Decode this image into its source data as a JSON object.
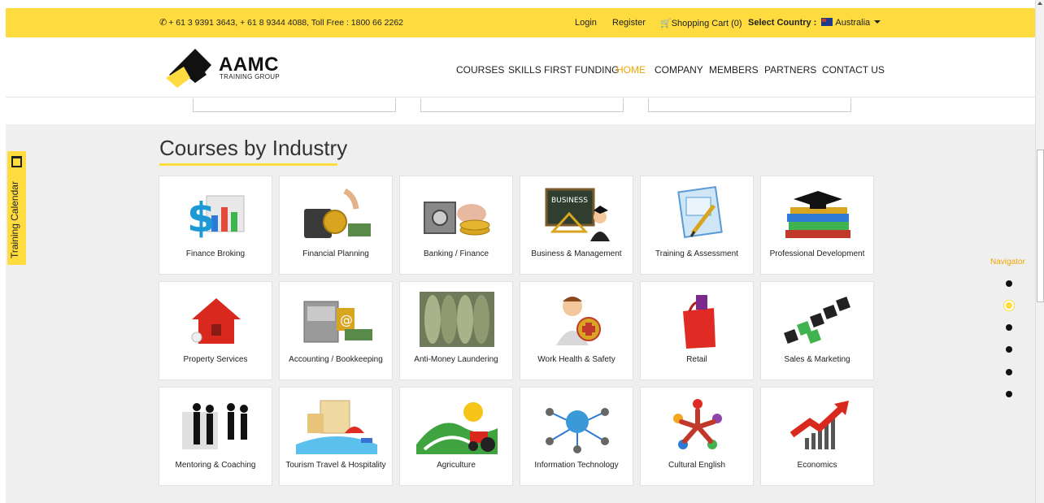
{
  "topbar": {
    "phone_icon": "phone-icon",
    "phone": "+ 61 3 9391 3643, + 61 8 9344 4088, Toll Free : 1800 66 2262",
    "login": "Login",
    "register": "Register",
    "cart_icon": "cart-icon",
    "cart": "Shopping Cart (0)",
    "country_label": "Select Country :",
    "country": "Australia"
  },
  "header": {
    "logo_title": "AAMC",
    "logo_sub": "TRAINING GROUP",
    "nav": [
      "COURSES",
      "SKILLS FIRST FUNDING",
      "HOME",
      "COMPANY",
      "MEMBERS",
      "PARTNERS",
      "CONTACT US"
    ],
    "active_nav": "HOME"
  },
  "section": {
    "title": "Courses by Industry"
  },
  "courses": [
    {
      "label": "Finance Broking",
      "icon": "finance-chart-icon"
    },
    {
      "label": "Financial Planning",
      "icon": "coins-icon"
    },
    {
      "label": "Banking / Finance",
      "icon": "safe-icon"
    },
    {
      "label": "Business & Management",
      "icon": "blackboard-icon"
    },
    {
      "label": "Training & Assessment",
      "icon": "certificate-icon"
    },
    {
      "label": "Professional Development",
      "icon": "graduation-books-icon"
    },
    {
      "label": "Property Services",
      "icon": "house-icon"
    },
    {
      "label": "Accounting / Bookkeeping",
      "icon": "file-cabinet-icon"
    },
    {
      "label": "Anti-Money Laundering",
      "icon": "money-rolls-icon"
    },
    {
      "label": "Work Health & Safety",
      "icon": "first-aid-icon"
    },
    {
      "label": "Retail",
      "icon": "shopping-bag-icon"
    },
    {
      "label": "Sales & Marketing",
      "icon": "market-blocks-icon"
    },
    {
      "label": "Mentoring & Coaching",
      "icon": "people-silhouette-icon"
    },
    {
      "label": "Tourism Travel & Hospitality",
      "icon": "hotel-beach-icon"
    },
    {
      "label": "Agriculture",
      "icon": "tractor-icon"
    },
    {
      "label": "Information Technology",
      "icon": "network-globe-icon"
    },
    {
      "label": "Cultural English",
      "icon": "star-people-icon"
    },
    {
      "label": "Economics",
      "icon": "growth-arrow-icon"
    }
  ],
  "sidebar": {
    "calendar_label": "Training Calendar"
  },
  "navigator": {
    "title": "Navigator",
    "dots": 6,
    "active_index": 1
  },
  "colors": {
    "accent_yellow": "#fedb3e",
    "active_nav": "#f0a500",
    "section_bg": "#efefef"
  }
}
